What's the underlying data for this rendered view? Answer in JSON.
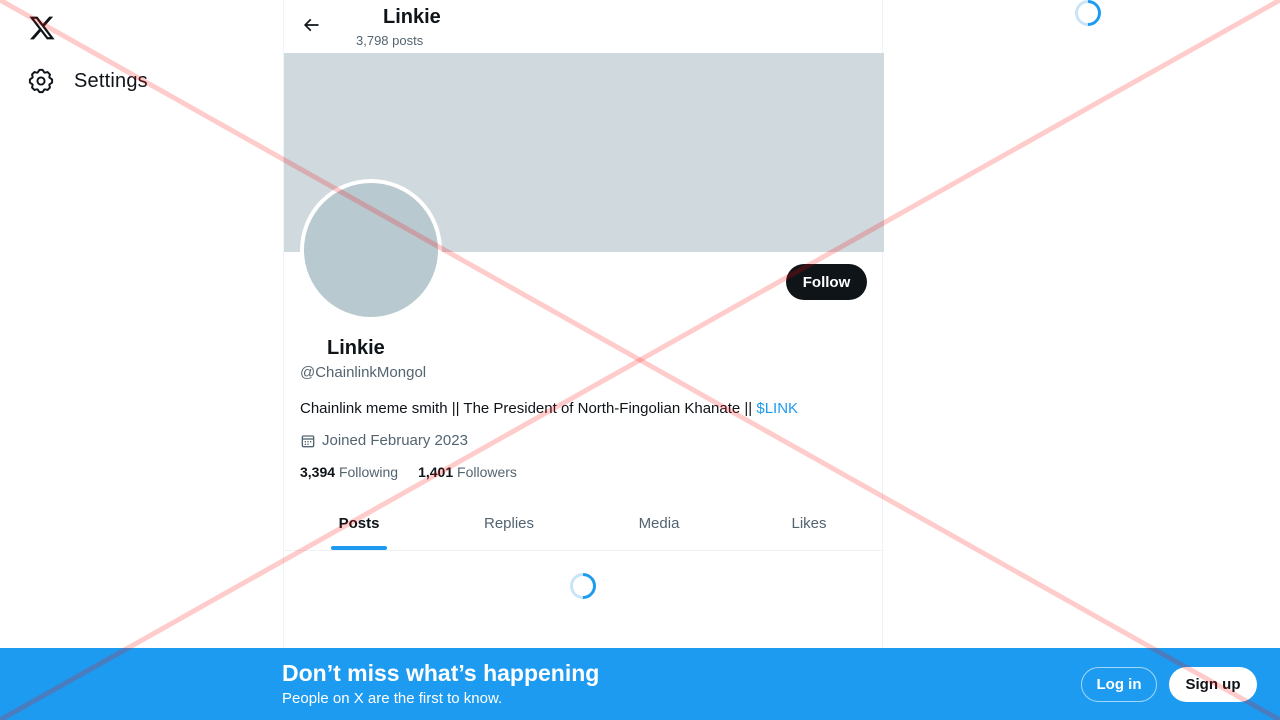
{
  "nav": {
    "logo_icon": "x-logo-icon",
    "settings_label": "Settings",
    "settings_icon": "gear-icon"
  },
  "header": {
    "title": "Linkie",
    "post_count": "3,798 posts",
    "back_icon": "arrow-left-icon"
  },
  "profile": {
    "name": "Linkie",
    "handle": "@ChainlinkMongol",
    "bio_text": "Chainlink meme smith  || The President of North-Fingolian Khanate || ",
    "bio_cashtag": "$LINK",
    "joined": "Joined February 2023",
    "following_count": "3,394",
    "following_label": "Following",
    "followers_count": "1,401",
    "followers_label": "Followers",
    "follow_label": "Follow",
    "banner_color": "#cfd9de",
    "avatar_color": "#b8c9d0"
  },
  "tabs": [
    {
      "label": "Posts",
      "active": true
    },
    {
      "label": "Replies",
      "active": false
    },
    {
      "label": "Media",
      "active": false
    },
    {
      "label": "Likes",
      "active": false
    }
  ],
  "bottom_bar": {
    "title": "Don’t miss what’s happening",
    "subtitle": "People on X are the first to know.",
    "login_label": "Log in",
    "signup_label": "Sign up",
    "background": "#1d9bf0"
  },
  "colors": {
    "accent": "#1d9bf0",
    "text_primary": "#0f1419",
    "text_secondary": "#536471"
  }
}
